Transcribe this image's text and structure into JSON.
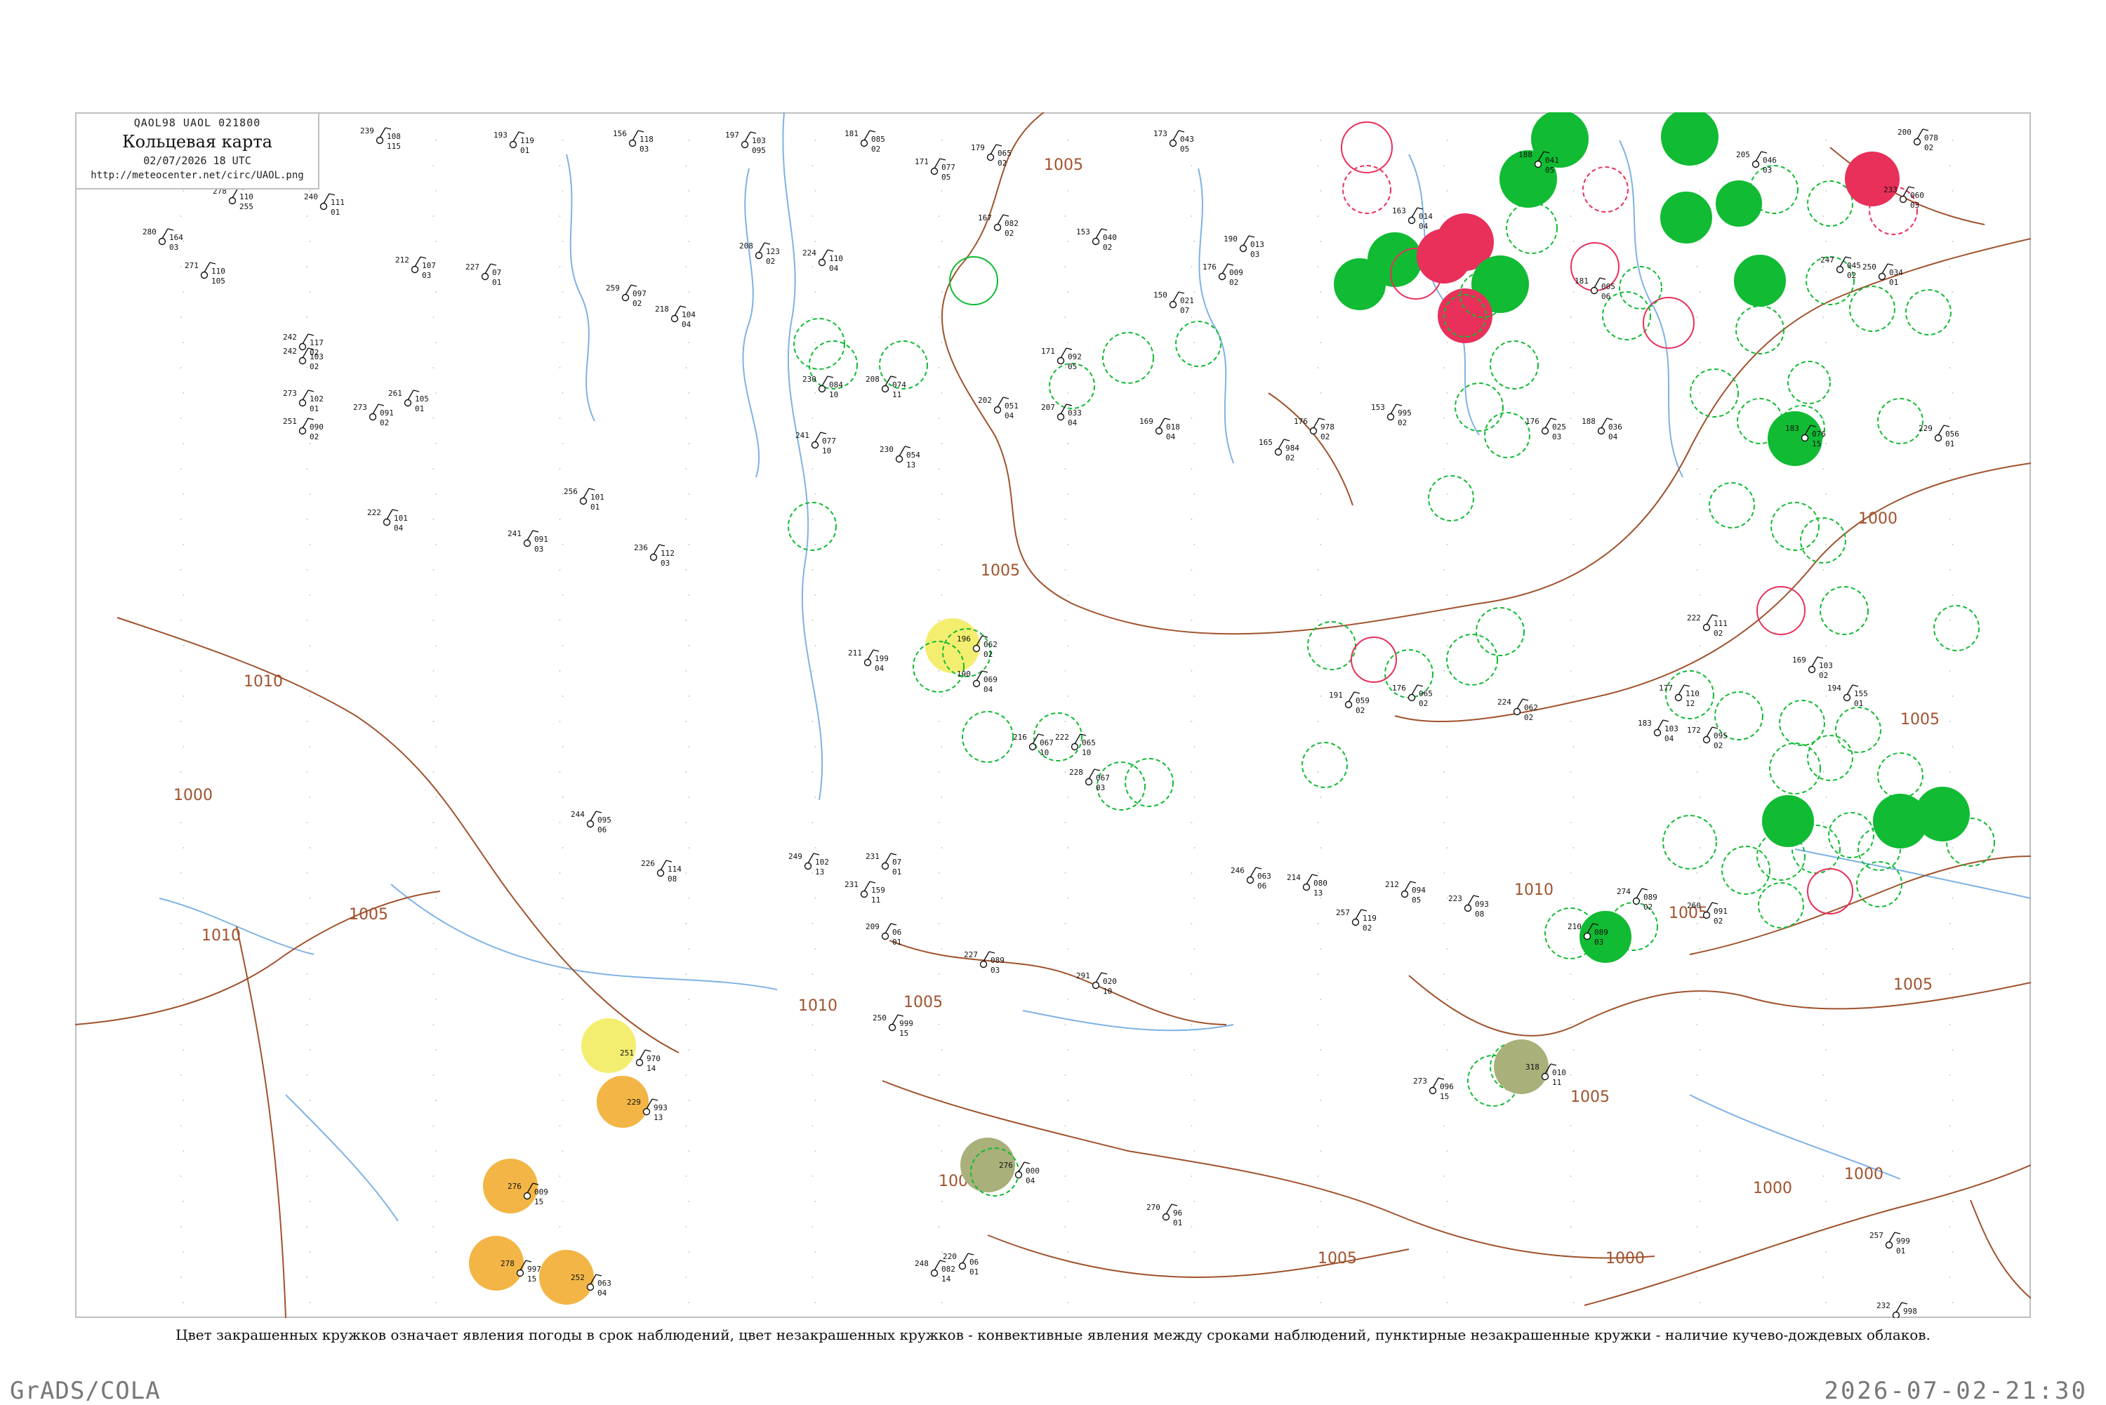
{
  "header": {
    "codes": "QAOL98  UAOL  021800",
    "title": "Кольцевая карта",
    "datetime": "02/07/2026 18 UTC",
    "url": "http://meteocenter.net/circ/UAOL.png"
  },
  "isobar_labels": [
    "1010",
    "1005",
    "1000",
    "1005",
    "1010",
    "1005",
    "1000",
    "1005",
    "1000",
    "1005",
    "1010",
    "1005",
    "1005",
    "1000",
    "1005",
    "1005",
    "1010",
    "1005",
    "1000"
  ],
  "stations": [
    {
      "t": "239",
      "p": "108",
      "w": "115"
    },
    {
      "t": "193",
      "p": "119",
      "w": "01"
    },
    {
      "t": "156",
      "p": "118",
      "w": "03"
    },
    {
      "t": "197",
      "p": "103",
      "w": "095"
    },
    {
      "t": "181",
      "p": "085",
      "w": "02"
    },
    {
      "t": "171",
      "p": "077",
      "w": "05"
    },
    {
      "t": "179",
      "p": "065",
      "w": "02"
    },
    {
      "t": "173",
      "p": "043",
      "w": "05"
    },
    {
      "t": "188",
      "p": "041",
      "w": "05"
    },
    {
      "t": "205",
      "p": "046",
      "w": "03"
    },
    {
      "t": "200",
      "p": "078",
      "w": "02"
    },
    {
      "t": "240",
      "p": "111",
      "w": "01"
    },
    {
      "t": "278",
      "p": "110",
      "w": "255"
    },
    {
      "t": "280",
      "p": "164",
      "w": "03"
    },
    {
      "t": "271",
      "p": "110",
      "w": "105"
    },
    {
      "t": "242",
      "p": "117",
      "w": "02"
    },
    {
      "t": "212",
      "p": "107",
      "w": "03"
    },
    {
      "t": "227",
      "p": "07",
      "w": "01"
    },
    {
      "t": "259",
      "p": "097",
      "w": "02"
    },
    {
      "t": "218",
      "p": "104",
      "w": "04"
    },
    {
      "t": "208",
      "p": "123",
      "w": "02"
    },
    {
      "t": "224",
      "p": "110",
      "w": "04"
    },
    {
      "t": "167",
      "p": "082",
      "w": "02"
    },
    {
      "t": "153",
      "p": "040",
      "w": "02"
    },
    {
      "t": "190",
      "p": "013",
      "w": "03"
    },
    {
      "t": "176",
      "p": "009",
      "w": "02"
    },
    {
      "t": "150",
      "p": "021",
      "w": "07"
    },
    {
      "t": "163",
      "p": "014",
      "w": "04"
    },
    {
      "t": "181",
      "p": "005",
      "w": "06"
    },
    {
      "t": "233",
      "p": "060",
      "w": "03"
    },
    {
      "t": "247",
      "p": "045",
      "w": "02"
    },
    {
      "t": "250",
      "p": "034",
      "w": "01"
    },
    {
      "t": "242",
      "p": "103",
      "w": "02"
    },
    {
      "t": "273",
      "p": "102",
      "w": "01"
    },
    {
      "t": "251",
      "p": "090",
      "w": "02"
    },
    {
      "t": "261",
      "p": "105",
      "w": "01"
    },
    {
      "t": "230",
      "p": "084",
      "w": "10"
    },
    {
      "t": "208",
      "p": "074",
      "w": "11"
    },
    {
      "t": "241",
      "p": "077",
      "w": "10"
    },
    {
      "t": "230",
      "p": "054",
      "w": "13"
    },
    {
      "t": "202",
      "p": "051",
      "w": "04"
    },
    {
      "t": "207",
      "p": "033",
      "w": "04"
    },
    {
      "t": "171",
      "p": "092",
      "w": "05"
    },
    {
      "t": "169",
      "p": "018",
      "w": "04"
    },
    {
      "t": "165",
      "p": "984",
      "w": "02"
    },
    {
      "t": "176",
      "p": "978",
      "w": "02"
    },
    {
      "t": "153",
      "p": "995",
      "w": "02"
    },
    {
      "t": "176",
      "p": "025",
      "w": "03"
    },
    {
      "t": "188",
      "p": "036",
      "w": "04"
    },
    {
      "t": "183",
      "p": "076",
      "w": "15"
    },
    {
      "t": "229",
      "p": "056",
      "w": "01"
    },
    {
      "t": "273",
      "p": "091",
      "w": "02"
    },
    {
      "t": "256",
      "p": "101",
      "w": "01"
    },
    {
      "t": "222",
      "p": "101",
      "w": "04"
    },
    {
      "t": "241",
      "p": "091",
      "w": "03"
    },
    {
      "t": "236",
      "p": "112",
      "w": "03"
    },
    {
      "t": "211",
      "p": "199",
      "w": "04"
    },
    {
      "t": "196",
      "p": "062",
      "w": "02"
    },
    {
      "t": "190",
      "p": "069",
      "w": "04"
    },
    {
      "t": "216",
      "p": "067",
      "w": "10"
    },
    {
      "t": "222",
      "p": "065",
      "w": "10"
    },
    {
      "t": "228",
      "p": "067",
      "w": "03"
    },
    {
      "t": "191",
      "p": "059",
      "w": "02"
    },
    {
      "t": "176",
      "p": "065",
      "w": "02"
    },
    {
      "t": "224",
      "p": "062",
      "w": "02"
    },
    {
      "t": "183",
      "p": "103",
      "w": "04"
    },
    {
      "t": "177",
      "p": "110",
      "w": "12"
    },
    {
      "t": "172",
      "p": "095",
      "w": "02"
    },
    {
      "t": "169",
      "p": "103",
      "w": "02"
    },
    {
      "t": "222",
      "p": "111",
      "w": "02"
    },
    {
      "t": "194",
      "p": "155",
      "w": "01"
    },
    {
      "t": "231",
      "p": "07",
      "w": "01"
    },
    {
      "t": "209",
      "p": "06",
      "w": "01"
    },
    {
      "t": "249",
      "p": "102",
      "w": "13"
    },
    {
      "t": "244",
      "p": "095",
      "w": "06"
    },
    {
      "t": "226",
      "p": "114",
      "w": "08"
    },
    {
      "t": "231",
      "p": "159",
      "w": "11"
    },
    {
      "t": "246",
      "p": "063",
      "w": "06"
    },
    {
      "t": "214",
      "p": "080",
      "w": "13"
    },
    {
      "t": "212",
      "p": "094",
      "w": "05"
    },
    {
      "t": "223",
      "p": "093",
      "w": "08"
    },
    {
      "t": "210",
      "p": "089",
      "w": "03"
    },
    {
      "t": "274",
      "p": "089",
      "w": "02"
    },
    {
      "t": "260",
      "p": "091",
      "w": "02"
    },
    {
      "t": "257",
      "p": "119",
      "w": "02"
    },
    {
      "t": "227",
      "p": "089",
      "w": "03"
    },
    {
      "t": "291",
      "p": "020",
      "w": "10"
    },
    {
      "t": "250",
      "p": "999",
      "w": "15"
    },
    {
      "t": "251",
      "p": "970",
      "w": "14"
    },
    {
      "t": "229",
      "p": "993",
      "w": "13"
    },
    {
      "t": "276",
      "p": "009",
      "w": "15"
    },
    {
      "t": "278",
      "p": "997",
      "w": "15"
    },
    {
      "t": "252",
      "p": "063",
      "w": "04"
    },
    {
      "t": "276",
      "p": "000",
      "w": "04"
    },
    {
      "t": "318",
      "p": "010",
      "w": "11"
    },
    {
      "t": "273",
      "p": "096",
      "w": "15"
    },
    {
      "t": "248",
      "p": "082",
      "w": "14"
    },
    {
      "t": "220",
      "p": "06",
      "w": "01"
    },
    {
      "t": "270",
      "p": "96",
      "w": "01"
    },
    {
      "t": "257",
      "p": "999",
      "w": "01"
    },
    {
      "t": "232",
      "p": "998",
      "w": "02"
    }
  ],
  "caption": "Цвет закрашенных кружков означает явления погоды в срок наблюдений, цвет незакрашенных кружков - конвективные явления между сроками наблюдений, пунктирные незакрашенные кружки - наличие кучево-дождевых облаков.",
  "footer": {
    "left": "GrADS/COLA",
    "right": "2026-07-02-21:30"
  },
  "colors": {
    "isobar": "#a0522d",
    "river": "#7fb2e5",
    "green": "#11bb33",
    "red": "#e8305a",
    "yellow": "#f4ee70",
    "orange": "#f3b545",
    "olive": "#a9b07a"
  }
}
